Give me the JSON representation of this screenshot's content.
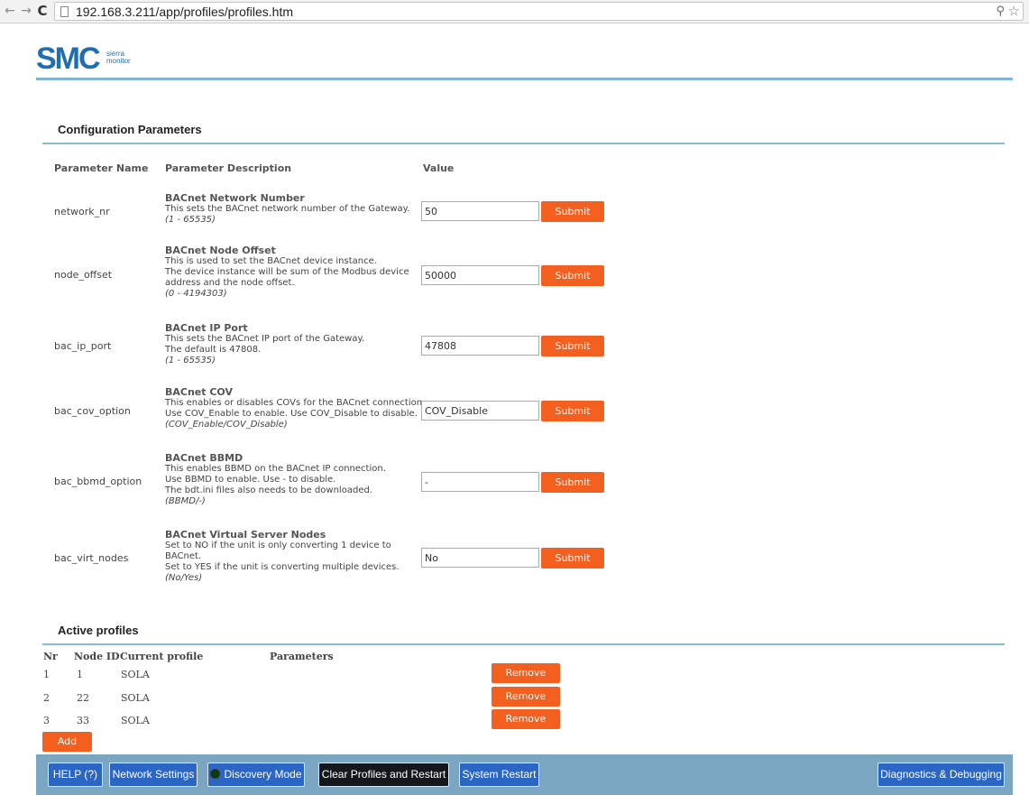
{
  "browser": {
    "url": "192.168.3.211/app/profiles/profiles.htm"
  },
  "logo": {
    "main": "SMC",
    "sub_line1": "sierra",
    "sub_line2": "monitor"
  },
  "config": {
    "title": "Configuration Parameters",
    "columns": {
      "name": "Parameter Name",
      "description": "Parameter Description",
      "value": "Value"
    },
    "submit_label": "Submit",
    "params": [
      {
        "name": "network_nr",
        "title": "BACnet Network Number",
        "lines": [
          "This sets the BACnet network number of the Gateway."
        ],
        "range": "(1 - 65535)",
        "value": "50"
      },
      {
        "name": "node_offset",
        "title": "BACnet Node Offset",
        "lines": [
          "This is used to set the BACnet device instance.",
          "The device instance will be sum of the Modbus device address and the node offset."
        ],
        "range": "(0 - 4194303)",
        "value": "50000"
      },
      {
        "name": "bac_ip_port",
        "title": "BACnet IP Port",
        "lines": [
          "This sets the BACnet IP port of the Gateway.",
          "The default is 47808."
        ],
        "range": "(1 - 65535)",
        "value": "47808"
      },
      {
        "name": "bac_cov_option",
        "title": "BACnet COV",
        "lines": [
          "This enables or disables COVs for the BACnet connection.",
          "Use COV_Enable to enable. Use COV_Disable to disable."
        ],
        "range": "(COV_Enable/COV_Disable)",
        "value": "COV_Disable"
      },
      {
        "name": "bac_bbmd_option",
        "title": "BACnet BBMD",
        "lines": [
          "This enables BBMD on the BACnet IP connection.",
          "Use BBMD to enable. Use - to disable.",
          "The bdt.ini files also needs to be downloaded."
        ],
        "range": "(BBMD/-)",
        "value": "-"
      },
      {
        "name": "bac_virt_nodes",
        "title": "BACnet Virtual Server Nodes",
        "lines": [
          "Set to NO if the unit is only converting 1 device to BACnet.",
          "Set to YES if the unit is converting multiple devices."
        ],
        "range": "(No/Yes)",
        "value": "No"
      }
    ]
  },
  "profiles": {
    "title": "Active profiles",
    "columns": {
      "nr": "Nr",
      "node_id": "Node ID",
      "current_profile": "Current profile",
      "parameters": "Parameters"
    },
    "remove_label": "Remove",
    "add_label": "Add",
    "rows": [
      {
        "nr": "1",
        "node_id": "1",
        "profile": "SOLA"
      },
      {
        "nr": "2",
        "node_id": "22",
        "profile": "SOLA"
      },
      {
        "nr": "3",
        "node_id": "33",
        "profile": "SOLA"
      }
    ]
  },
  "footer": {
    "help": "HELP (?)",
    "network_settings": "Network Settings",
    "discovery_mode": "Discovery Mode",
    "clear_profiles": "Clear Profiles and Restart",
    "system_restart": "System Restart",
    "diagnostics": "Diagnostics & Debugging"
  },
  "colors": {
    "accent_orange": "#f35f1e",
    "footer_bar": "#7aa6c2",
    "footer_button": "#2b66c4",
    "rule": "#87bdd3"
  }
}
